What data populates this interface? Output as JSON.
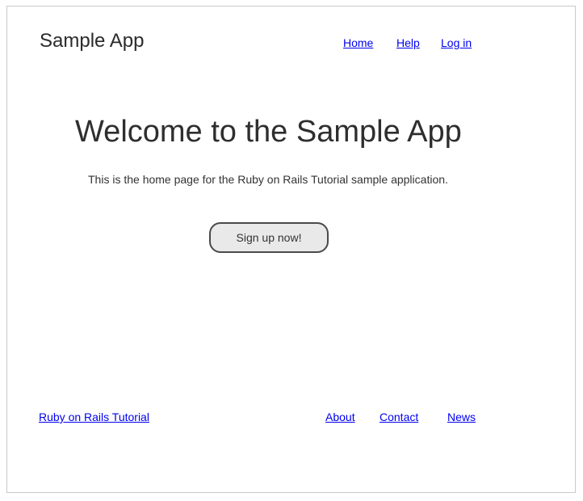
{
  "header": {
    "logo": "Sample App",
    "nav": {
      "home": "Home",
      "help": "Help",
      "login": "Log in"
    }
  },
  "hero": {
    "title": "Welcome to the Sample App",
    "text": "This is the home page for the Ruby on Rails Tutorial sample application.",
    "signup_label": "Sign up now!"
  },
  "footer": {
    "brand_link": "Ruby on Rails Tutorial",
    "links": {
      "about": "About",
      "contact": "Contact",
      "news": "News"
    }
  },
  "colors": {
    "link": "#0000ee",
    "text": "#333333",
    "button_bg": "#e9e9e9",
    "button_border": "#4a4a4a",
    "frame_border": "#c9c9c9"
  }
}
